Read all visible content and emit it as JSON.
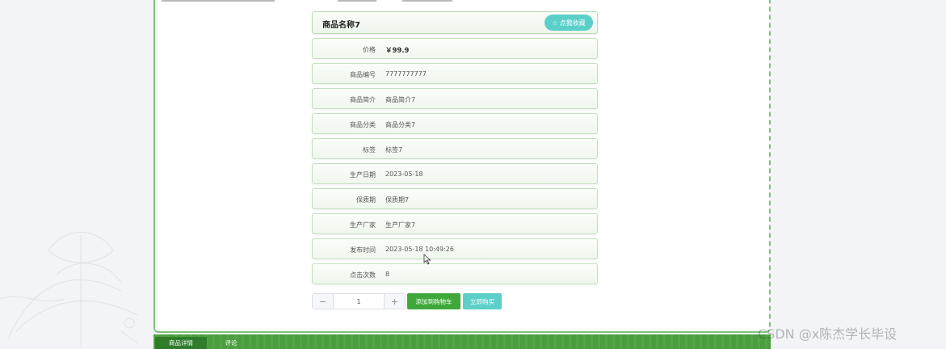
{
  "product": {
    "name": "商品名称7",
    "favorite_label": "收藏",
    "favorite_label_full": "点我收藏"
  },
  "details": [
    {
      "label": "价格",
      "value": "￥99.9"
    },
    {
      "label": "商品编号",
      "value": "7777777777"
    },
    {
      "label": "商品简介",
      "value": "商品简介7"
    },
    {
      "label": "商品分类",
      "value": "商品分类7"
    },
    {
      "label": "标签",
      "value": "标签7"
    },
    {
      "label": "生产日期",
      "value": "2023-05-18"
    },
    {
      "label": "保质期",
      "value": "保质期7"
    },
    {
      "label": "生产厂家",
      "value": "生产厂家7"
    },
    {
      "label": "发布时间",
      "value": "2023-05-18 10:49:26"
    },
    {
      "label": "点击次数",
      "value": "8"
    }
  ],
  "purchase": {
    "minus": "−",
    "plus": "+",
    "quantity": "1",
    "add_to_cart": "添加到购物车",
    "buy_now": "立即购买"
  },
  "tabs": [
    {
      "label": "商品详情"
    },
    {
      "label": "评论"
    }
  ],
  "watermark": "CSDN @x陈杰学长毕设",
  "colors": {
    "accent_green": "#3fa83a",
    "teal": "#5ccfc9",
    "tab_bar": "#4a9e3e"
  }
}
